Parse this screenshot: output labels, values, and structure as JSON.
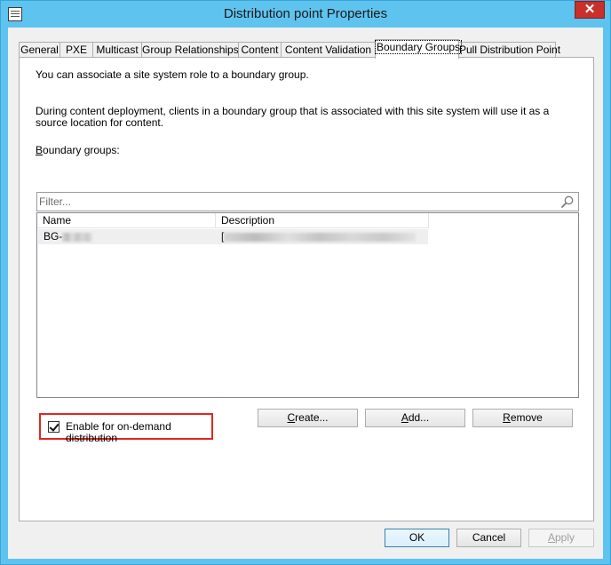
{
  "window": {
    "title": "Distribution point Properties",
    "close_label": "✕"
  },
  "tabs": [
    {
      "label": "General"
    },
    {
      "label": "PXE"
    },
    {
      "label": "Multicast"
    },
    {
      "label": "Group Relationships"
    },
    {
      "label": "Content"
    },
    {
      "label": "Content Validation"
    },
    {
      "label": "Boundary Groups"
    },
    {
      "label": "Pull Distribution Point"
    }
  ],
  "active_tab": "Boundary Groups",
  "panel": {
    "intro": "You can associate a site system role to a boundary group.",
    "description": "During content deployment, clients in a boundary group that is associated with this site system will use it as a source location for content.",
    "boundary_label_first": "B",
    "boundary_label_rest": "oundary groups:",
    "filter_placeholder": "Filter...",
    "columns": [
      "Name",
      "Description"
    ],
    "rows": [
      {
        "name": "BG-",
        "description": "["
      }
    ],
    "buttons": {
      "create_u": "C",
      "create_rest": "reate...",
      "add_u": "A",
      "add_rest": "dd...",
      "remove_u": "R",
      "remove_rest": "emove"
    },
    "ondemand_label": "Enable for on-demand distribution",
    "ondemand_checked": true
  },
  "footer": {
    "ok": "OK",
    "cancel": "Cancel",
    "apply_u": "A",
    "apply_rest": "pply"
  },
  "colors": {
    "titlebar": "#5ec3ef",
    "close": "#c7302b",
    "highlight_box": "#e0261f"
  }
}
